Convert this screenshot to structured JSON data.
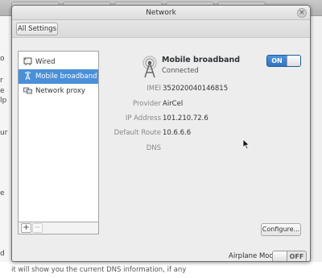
{
  "window": {
    "title": "Network",
    "close_glyph": "×",
    "toolbar": {
      "all_settings_label": "All Settings"
    }
  },
  "background": {
    "bottom_text": "it will show you the current DNS information, if any",
    "left_fragments": [
      "o",
      "r",
      "e",
      "lp",
      "ur",
      "e",
      "d"
    ]
  },
  "device_list": {
    "items": [
      {
        "label": "Wired",
        "icon": "wired-icon",
        "selected": false
      },
      {
        "label": "Mobile broadband",
        "icon": "mobile-broadband-icon",
        "selected": true
      },
      {
        "label": "Network proxy",
        "icon": "network-proxy-icon",
        "selected": false
      }
    ],
    "add_label": "+",
    "remove_label": "−"
  },
  "details": {
    "device_name": "Mobile broadband",
    "status": "Connected",
    "switch_label": "ON",
    "properties": [
      {
        "label": "IMEI",
        "value": "352020040146815"
      },
      {
        "label": "Provider",
        "value": "AirCel"
      },
      {
        "label": "IP Address",
        "value": "101.210.72.6"
      },
      {
        "label": "Default Route",
        "value": "10.6.6.6"
      },
      {
        "label": "DNS",
        "value": ""
      }
    ],
    "configure_label": "Configure..."
  },
  "airplane_mode": {
    "label": "Airplane Mode",
    "state_label": "OFF"
  },
  "colors": {
    "accent": "#4a90d9",
    "switch_on": "#2f74c2"
  }
}
